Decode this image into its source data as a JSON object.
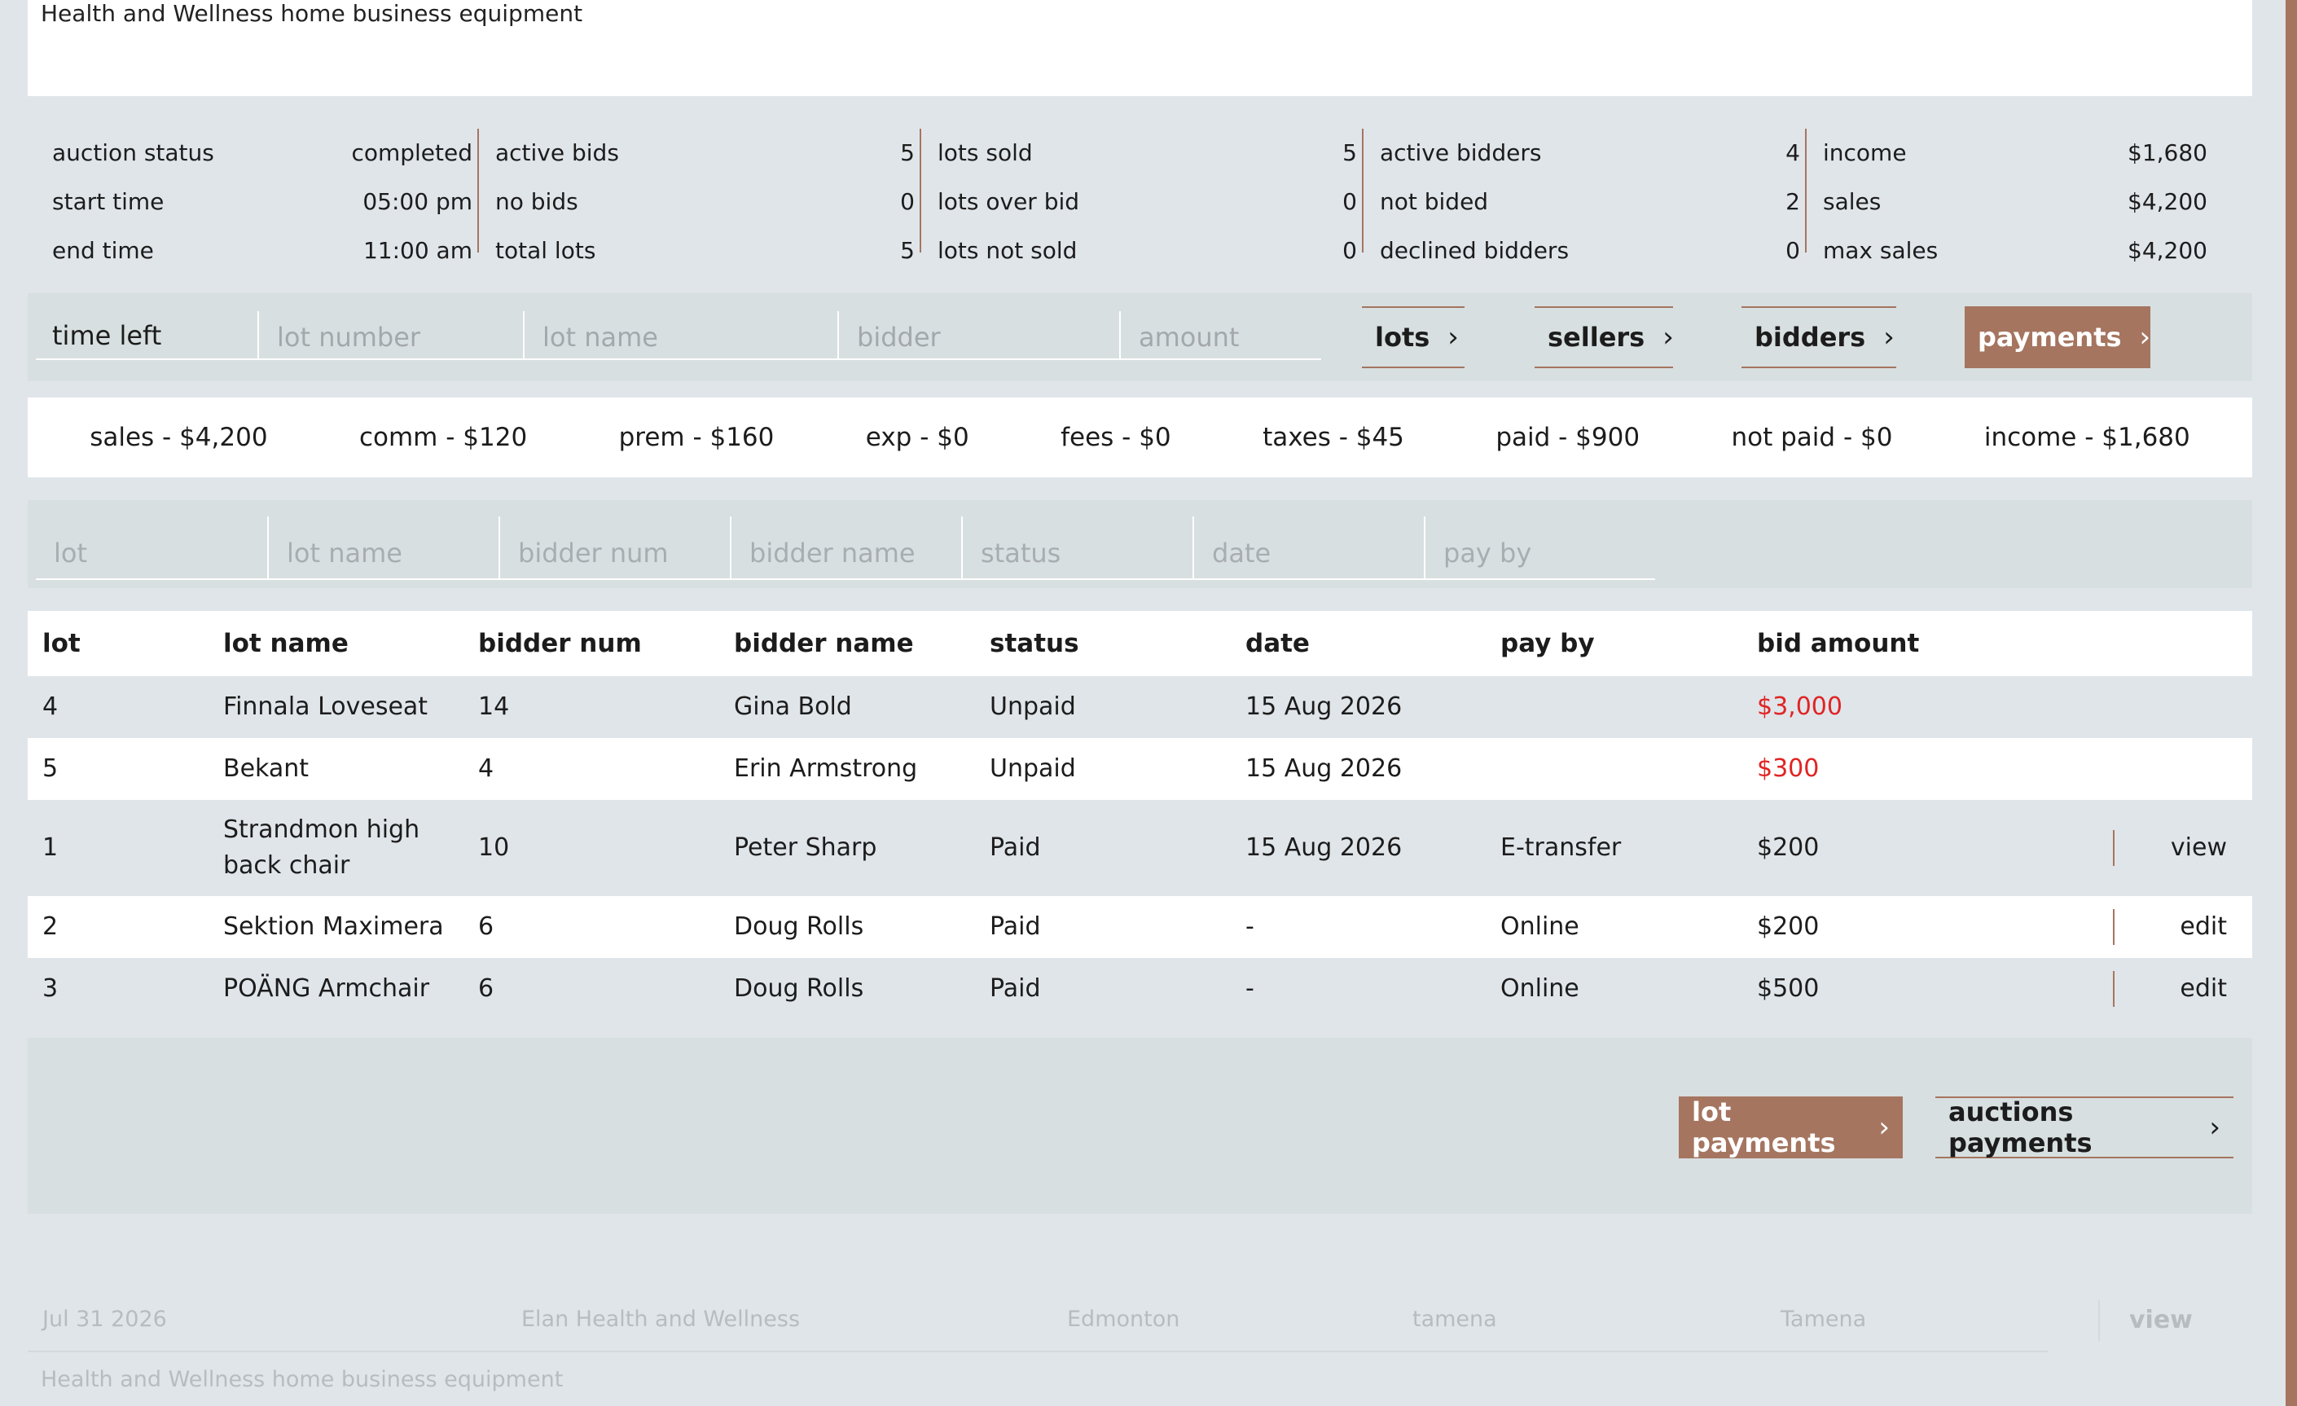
{
  "header": {
    "title": "Health and Wellness home business equipment"
  },
  "stats": {
    "col1": [
      {
        "label": "auction status",
        "value": "completed"
      },
      {
        "label": "start time",
        "value": "05:00 pm"
      },
      {
        "label": "end time",
        "value": "11:00 am"
      }
    ],
    "col2": [
      {
        "label": "active bids",
        "value": "5"
      },
      {
        "label": "no bids",
        "value": "0"
      },
      {
        "label": "total lots",
        "value": "5"
      }
    ],
    "col3": [
      {
        "label": "lots sold",
        "value": "5"
      },
      {
        "label": "lots over bid",
        "value": "0"
      },
      {
        "label": "lots not sold",
        "value": "0"
      }
    ],
    "col4": [
      {
        "label": "active bidders",
        "value": "4"
      },
      {
        "label": "not bided",
        "value": "2"
      },
      {
        "label": "declined bidders",
        "value": "0"
      }
    ],
    "col5": [
      {
        "label": "income",
        "value": "$1,680"
      },
      {
        "label": "sales",
        "value": "$4,200"
      },
      {
        "label": "max sales",
        "value": "$4,200"
      }
    ]
  },
  "search": {
    "time_left": "time left",
    "lot_number": "lot number",
    "lot_name": "lot name",
    "bidder": "bidder",
    "amount": "amount"
  },
  "nav": {
    "lots": "lots",
    "sellers": "sellers",
    "bidders": "bidders",
    "payments": "payments",
    "accent": "#a57560"
  },
  "summary": [
    "sales - $4,200",
    "comm - $120",
    "prem - $160",
    "exp - $0",
    "fees - $0",
    "taxes - $45",
    "paid - $900",
    "not paid - $0",
    "income - $1,680"
  ],
  "filters": {
    "lot": "lot",
    "lot_name": "lot name",
    "bidder_num": "bidder num",
    "bidder_name": "bidder name",
    "status": "status",
    "date": "date",
    "pay_by": "pay by"
  },
  "table": {
    "headers": {
      "lot": "lot",
      "lot_name": "lot name",
      "bidder_num": "bidder num",
      "bidder_name": "bidder name",
      "status": "status",
      "date": "date",
      "pay_by": "pay by",
      "bid_amount": "bid amount"
    },
    "rows": [
      {
        "lot": "4",
        "lot_name": "Finnala Loveseat",
        "bidder_num": "14",
        "bidder_name": "Gina Bold",
        "status": "Unpaid",
        "date": "15 Aug 2026",
        "pay_by": "",
        "bid_amount": "$3,000",
        "action": ""
      },
      {
        "lot": "5",
        "lot_name": "Bekant",
        "bidder_num": "4",
        "bidder_name": "Erin Armstrong",
        "status": "Unpaid",
        "date": "15 Aug 2026",
        "pay_by": "",
        "bid_amount": "$300",
        "action": ""
      },
      {
        "lot": "1",
        "lot_name": "Strandmon high back chair",
        "bidder_num": "10",
        "bidder_name": "Peter Sharp",
        "status": "Paid",
        "date": "15 Aug 2026",
        "pay_by": "E-transfer",
        "bid_amount": "$200",
        "action": "view"
      },
      {
        "lot": "2",
        "lot_name": "Sektion Maximera",
        "bidder_num": "6",
        "bidder_name": "Doug Rolls",
        "status": "Paid",
        "date": "-",
        "pay_by": "Online",
        "bid_amount": "$200",
        "action": "edit"
      },
      {
        "lot": "3",
        "lot_name": "POÄNG Armchair",
        "bidder_num": "6",
        "bidder_name": "Doug Rolls",
        "status": "Paid",
        "date": "-",
        "pay_by": "Online",
        "bid_amount": "$500",
        "action": "edit"
      }
    ],
    "unpaid_color": "#e02424"
  },
  "actions": {
    "lot_payments": "lot payments",
    "auctions_payments": "auctions payments"
  },
  "footer": {
    "date": "Jul 31 2026",
    "org": "Elan Health and Wellness",
    "city": "Edmonton",
    "user": "tamena",
    "user_name": "Tamena",
    "view": "view",
    "subtitle": "Health and Wellness home business equipment"
  }
}
